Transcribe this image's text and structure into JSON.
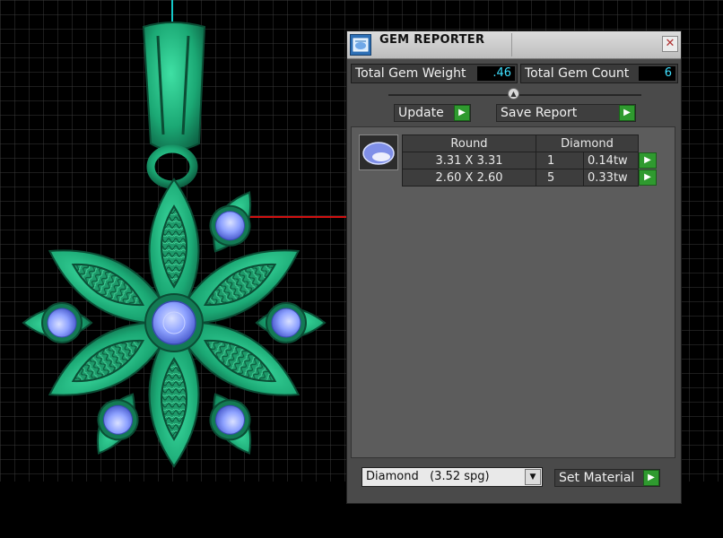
{
  "window": {
    "title": "GEM REPORTER",
    "close_icon": "close-icon",
    "title_icon": "gem-reporter-icon"
  },
  "stats": {
    "total_gem_weight_label": "Total Gem Weight",
    "total_gem_weight_value": ".46",
    "total_gem_count_label": "Total Gem Count",
    "total_gem_count_value": "6"
  },
  "actions": {
    "update_label": "Update",
    "save_report_label": "Save Report",
    "play_icon": "play-arrow-icon"
  },
  "gem_table": {
    "shape_header": "Round",
    "material_header": "Diamond",
    "rows": [
      {
        "size": "3.31 X 3.31",
        "count": "1",
        "weight": "0.14tw"
      },
      {
        "size": "2.60 X 2.60",
        "count": "5",
        "weight": "0.33tw"
      }
    ]
  },
  "material": {
    "selected_name": "Diamond",
    "selected_spg": "(3.52 spg)",
    "set_material_label": "Set Material"
  },
  "colors": {
    "panel_bg": "#4a4a4a",
    "value_text": "#3fe0ff",
    "go_button": "#2f9a2f",
    "metal": "#1fae78",
    "gem": "#8ea2ff",
    "axis_red": "#d01010",
    "axis_cyan": "#14c8c8"
  }
}
